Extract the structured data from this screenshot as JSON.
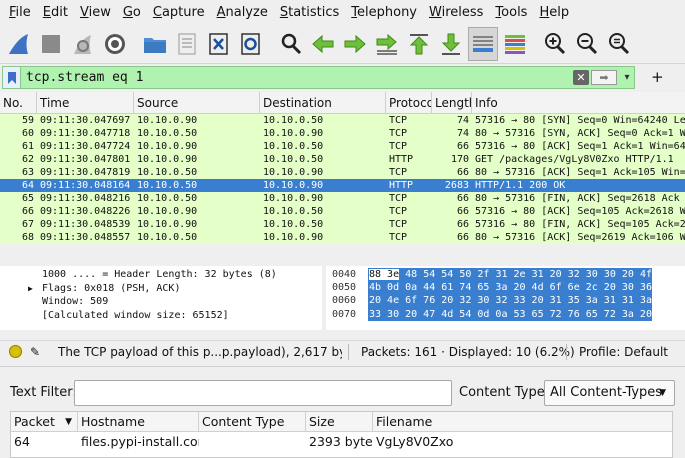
{
  "menu": [
    "File",
    "Edit",
    "View",
    "Go",
    "Capture",
    "Analyze",
    "Statistics",
    "Telephony",
    "Wireless",
    "Tools",
    "Help"
  ],
  "filter": {
    "value": "tcp.stream eq 1"
  },
  "packet_list": {
    "columns": [
      "No.",
      "Time",
      "Source",
      "Destination",
      "Protocol",
      "Length",
      "Info"
    ],
    "rows": [
      {
        "no": "59",
        "time": "09:11:30.047697",
        "src": "10.10.0.90",
        "dst": "10.10.0.50",
        "proto": "TCP",
        "len": "74",
        "info": "57316 → 80 [SYN] Seq=0 Win=64240 Len=0",
        "selected": false
      },
      {
        "no": "60",
        "time": "09:11:30.047718",
        "src": "10.10.0.50",
        "dst": "10.10.0.90",
        "proto": "TCP",
        "len": "74",
        "info": "80 → 57316 [SYN, ACK] Seq=0 Ack=1 Win",
        "selected": false
      },
      {
        "no": "61",
        "time": "09:11:30.047724",
        "src": "10.10.0.90",
        "dst": "10.10.0.50",
        "proto": "TCP",
        "len": "66",
        "info": "57316 → 80 [ACK] Seq=1 Ack=1 Win=64",
        "selected": false
      },
      {
        "no": "62",
        "time": "09:11:30.047801",
        "src": "10.10.0.90",
        "dst": "10.10.0.50",
        "proto": "HTTP",
        "len": "170",
        "info": "GET /packages/VgLy8V0Zxo HTTP/1.1",
        "selected": false
      },
      {
        "no": "63",
        "time": "09:11:30.047819",
        "src": "10.10.0.50",
        "dst": "10.10.0.90",
        "proto": "TCP",
        "len": "66",
        "info": "80 → 57316 [ACK] Seq=1 Ack=105 Win=",
        "selected": false
      },
      {
        "no": "64",
        "time": "09:11:30.048164",
        "src": "10.10.0.50",
        "dst": "10.10.0.90",
        "proto": "HTTP",
        "len": "2683",
        "info": "HTTP/1.1 200 OK",
        "selected": true
      },
      {
        "no": "65",
        "time": "09:11:30.048216",
        "src": "10.10.0.50",
        "dst": "10.10.0.90",
        "proto": "TCP",
        "len": "66",
        "info": "80 → 57316 [FIN, ACK] Seq=2618 Ack",
        "selected": false
      },
      {
        "no": "66",
        "time": "09:11:30.048226",
        "src": "10.10.0.90",
        "dst": "10.10.0.50",
        "proto": "TCP",
        "len": "66",
        "info": "57316 → 80 [ACK] Seq=105 Ack=2618 W",
        "selected": false
      },
      {
        "no": "67",
        "time": "09:11:30.048539",
        "src": "10.10.0.90",
        "dst": "10.10.0.50",
        "proto": "TCP",
        "len": "66",
        "info": "57316 → 80 [FIN, ACK] Seq=105 Ack=2",
        "selected": false
      },
      {
        "no": "68",
        "time": "09:11:30.048557",
        "src": "10.10.0.50",
        "dst": "10.10.0.90",
        "proto": "TCP",
        "len": "66",
        "info": "80 → 57316 [ACK] Seq=2619 Ack=106 W",
        "selected": false
      }
    ]
  },
  "details": [
    {
      "text": "1000 .... = Header Length: 32 bytes (8)",
      "expandable": false
    },
    {
      "text": "Flags: 0x018 (PSH, ACK)",
      "expandable": true
    },
    {
      "text": "Window: 509",
      "expandable": false
    },
    {
      "text": "[Calculated window size: 65152]",
      "expandable": false
    }
  ],
  "bytes": [
    {
      "offset": "0040",
      "pre": "88 3e",
      "hex": "48 54 54 50 2f 31  2e 31 20 32 30 30 20 4f"
    },
    {
      "offset": "0050",
      "pre": "",
      "hex": "4b 0d 0a 44 61 74 65 3a  20 4d 6f 6e 2c 20 30 36"
    },
    {
      "offset": "0060",
      "pre": "",
      "hex": "20 4e 6f 76 20 32 30 32  33 20 31 35 3a 31 31 3a"
    },
    {
      "offset": "0070",
      "pre": "",
      "hex": "33 30 20 47 4d 54 0d 0a  53 65 72 76 65 72 3a 20"
    }
  ],
  "status": {
    "message": "The TCP payload of this p...p.payload), 2,617 byte(s)",
    "packets": "Packets: 161 · Displayed: 10 (6.2%)",
    "profile": "Profile: Default"
  },
  "export": {
    "text_filter_label": "Text Filter:",
    "text_filter_value": "",
    "content_type_label": "Content Type:",
    "content_type_value": "All Content-Types",
    "columns": [
      "Packet",
      "Hostname",
      "Content Type",
      "Size",
      "Filename"
    ],
    "rows": [
      {
        "packet": "64",
        "hostname": "files.pypi-install.com",
        "content_type": "",
        "size": "2393 bytes",
        "filename": "VgLy8V0Zxo"
      }
    ]
  }
}
